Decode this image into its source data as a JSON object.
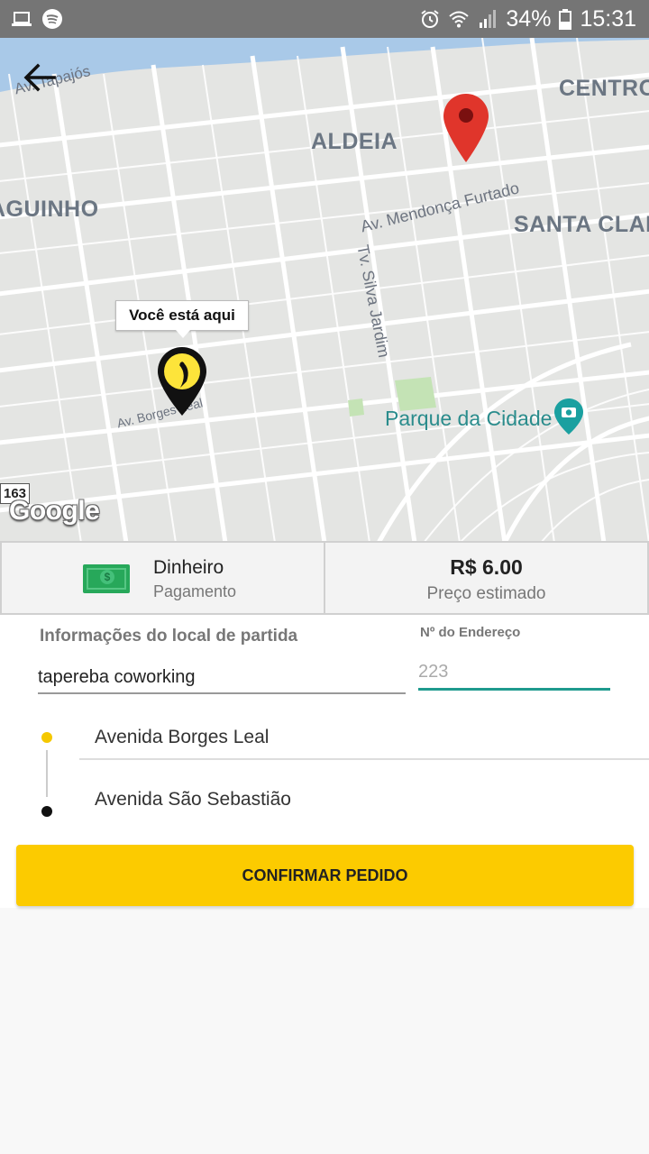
{
  "status_bar": {
    "battery": "34%",
    "time": "15:31"
  },
  "map": {
    "labels": {
      "centro": "CENTRO",
      "aldeia": "ALDEIA",
      "aguinho": "AGUINHO",
      "santa_clara": "SANTA CLARA",
      "av_tapajos": "Av. Tapajós",
      "av_mendonca": "Av. Mendonça Furtado",
      "tv_silva": "Tv. Silva Jardim",
      "av_borges": "Av. Borges Leal",
      "parque": "Parque da Cidade",
      "route": "163"
    },
    "tooltip": "Você está aqui",
    "google": "Google"
  },
  "payment": {
    "method": "Dinheiro",
    "label": "Pagamento"
  },
  "price": {
    "value": "R$ 6.00",
    "label": "Preço estimado"
  },
  "form": {
    "section_title": "Informações do local de partida",
    "number_label": "Nº do Endereço",
    "place_value": "tapereba coworking",
    "number_placeholder": "223",
    "origin": "Avenida Borges Leal",
    "destination": "Avenida São Sebastião",
    "confirm": "CONFIRMAR PEDIDO"
  },
  "colors": {
    "accent": "#fccb00",
    "teal": "#1e9a8e",
    "map_bg": "#e5e5e5"
  },
  "icons": [
    "laptop-icon",
    "spotify-icon",
    "alarm-icon",
    "wifi-icon",
    "signal-icon",
    "battery-icon",
    "back-arrow-icon",
    "user-location-pin-icon",
    "destination-pin-icon",
    "money-icon",
    "camera-icon"
  ]
}
